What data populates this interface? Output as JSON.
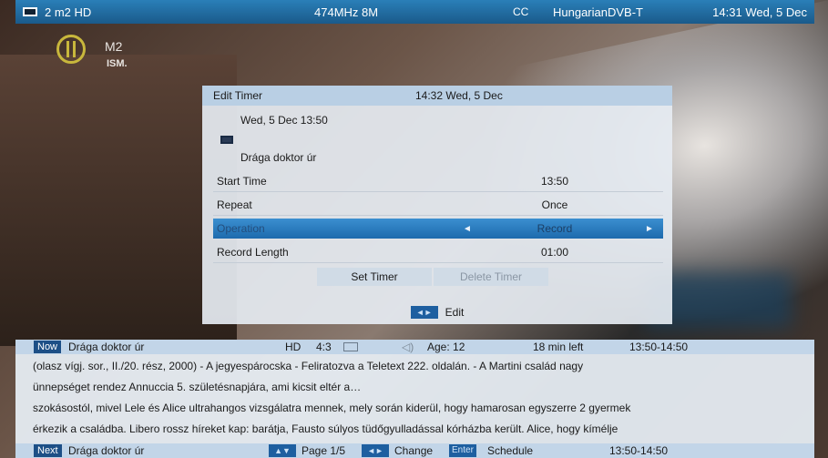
{
  "topbar": {
    "channel": "2 m2 HD",
    "frequency": "474MHz 8M",
    "cc_symbol": "CC",
    "network": "HungarianDVB-T",
    "clock": "14:31 Wed, 5 Dec"
  },
  "channel_logo": {
    "name": "M2",
    "sub": "ISM."
  },
  "dialog": {
    "title": "Edit Timer",
    "clock": "14:32 Wed, 5 Dec",
    "program_date": "Wed, 5 Dec 13:50",
    "program_title": "Drága doktor úr",
    "rows": [
      {
        "label": "Start Time",
        "value": "13:50"
      },
      {
        "label": "Repeat",
        "value": "Once"
      },
      {
        "label": "Operation",
        "value": "Record"
      },
      {
        "label": "Record Length",
        "value": "01:00"
      }
    ],
    "set_timer": "Set Timer",
    "delete_timer": "Delete Timer",
    "footer_hint": "Edit"
  },
  "info": {
    "now_tag": "Now",
    "now_title": "Drága doktor úr",
    "format": "HD",
    "aspect": "4:3",
    "age": "Age: 12",
    "time_left": "18 min left",
    "time_range": "13:50-14:50",
    "description_lines": [
      "(olasz vígj. sor., II./20. rész, 2000) - A jegyespárocska - Feliratozva a Teletext 222. oldalán.  - A Martini család nagy",
      "ünnepséget rendez Annuccia 5. születésnapjára, ami kicsit eltér a…",
      "szokásostól, mivel Lele és Alice ultrahangos vizsgálatra mennek, mely során kiderül, hogy hamarosan egyszerre 2 gyermek",
      "érkezik a családba. Libero rossz híreket kap: barátja, Fausto súlyos tüdőgyulladással kórházba került. Alice, hogy kímélje"
    ],
    "next_tag": "Next",
    "next_title": "Drága doktor úr",
    "page": "Page 1/5",
    "change": "Change",
    "enter_key": "Enter",
    "schedule": "Schedule",
    "next_time_range": "13:50-14:50"
  }
}
